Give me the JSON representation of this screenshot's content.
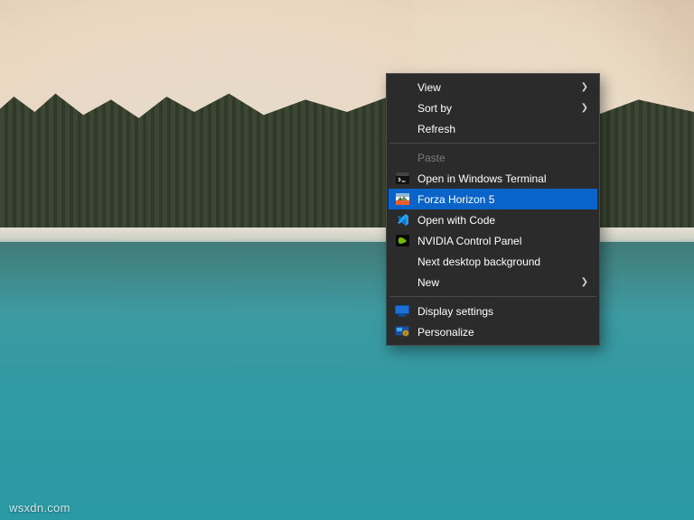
{
  "watermark": "wsxdn.com",
  "menu": {
    "selected_index": 5,
    "groups": [
      [
        {
          "label": "View",
          "submenu": true,
          "icon": null
        },
        {
          "label": "Sort by",
          "submenu": true,
          "icon": null
        },
        {
          "label": "Refresh",
          "submenu": false,
          "icon": null
        }
      ],
      [
        {
          "label": "Paste",
          "submenu": false,
          "icon": null,
          "disabled": true
        },
        {
          "label": "Open in Windows Terminal",
          "submenu": false,
          "icon": "terminal-icon"
        },
        {
          "label": "Forza Horizon 5",
          "submenu": false,
          "icon": "forza-icon",
          "selected": true
        },
        {
          "label": "Open with Code",
          "submenu": false,
          "icon": "vscode-icon"
        },
        {
          "label": "NVIDIA Control Panel",
          "submenu": false,
          "icon": "nvidia-icon"
        },
        {
          "label": "Next desktop background",
          "submenu": false,
          "icon": null
        },
        {
          "label": "New",
          "submenu": true,
          "icon": null
        }
      ],
      [
        {
          "label": "Display settings",
          "submenu": false,
          "icon": "display-icon"
        },
        {
          "label": "Personalize",
          "submenu": false,
          "icon": "personalize-icon"
        }
      ]
    ]
  },
  "colors": {
    "menu_bg": "#2b2b2b",
    "menu_border": "#4a4a4a",
    "highlight": "#0a63c9",
    "text": "#ffffff",
    "text_disabled": "#7a7a7a"
  }
}
